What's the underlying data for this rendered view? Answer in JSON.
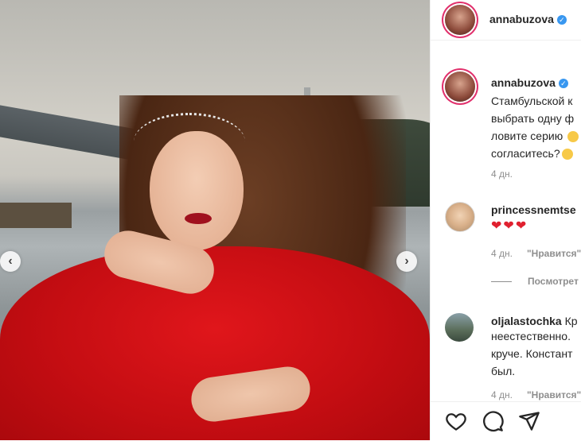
{
  "post": {
    "username": "annabuzova",
    "verified_mark": "✓"
  },
  "caption": {
    "username": "annabuzova",
    "lines": [
      "Стамбульской к",
      "выбрать одну ф",
      "ловите серию",
      "согласитесь?"
    ],
    "time": "4 дн."
  },
  "comments": [
    {
      "username": "princessnemtse",
      "text": "❤❤❤",
      "time": "4 дн.",
      "like_label": "\"Нравится\"",
      "replies_label": "Посмотрет"
    },
    {
      "username": "oljalastochka",
      "text_first": "Кр",
      "lines": [
        "неестественно.",
        "круче. Констант",
        "был."
      ],
      "time": "4 дн.",
      "like_label": "\"Нравится\""
    }
  ],
  "carousel": {
    "prev_icon": "chevron-left-icon",
    "next_icon": "chevron-right-icon",
    "prev_glyph": "‹",
    "next_glyph": "›"
  },
  "actions": {
    "like_icon": "heart-icon",
    "comment_icon": "comment-icon",
    "share_icon": "send-icon"
  },
  "colors": {
    "verified": "#3897f0",
    "story_ring": "#e1306c",
    "text": "#262626",
    "secondary": "#8e8e8e"
  }
}
